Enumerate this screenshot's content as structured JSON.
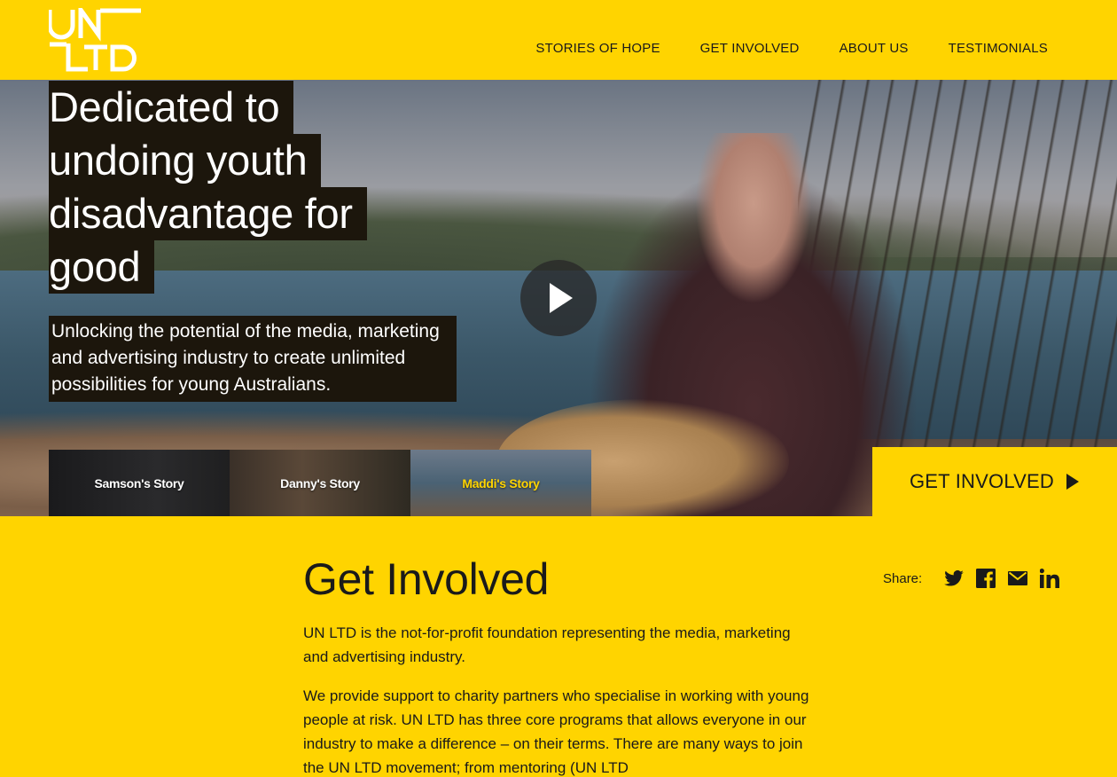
{
  "logo": {
    "line1": "UN",
    "line2": "LTD"
  },
  "nav": {
    "items": [
      "STORIES OF HOPE",
      "GET INVOLVED",
      "ABOUT US",
      "TESTIMONIALS"
    ]
  },
  "hero": {
    "headline": [
      "Dedicated to",
      "undoing youth",
      "disadvantage for",
      "good"
    ],
    "subline": "Unlocking the potential of the media, marketing and advertising industry to create unlimited possibilities for young Australians.",
    "play_icon": "play-icon",
    "stories": [
      {
        "label": "Samson's Story",
        "active": false
      },
      {
        "label": "Danny's Story",
        "active": false
      },
      {
        "label": "Maddi's Story",
        "active": true
      }
    ],
    "cta_label": "GET INVOLVED"
  },
  "main": {
    "title": "Get Involved",
    "paragraphs": [
      "UN LTD is the not-for-profit foundation representing the media, marketing and advertising industry.",
      "We provide support to charity partners who specialise in working with young people at risk. UN LTD has three core programs that allows everyone in our industry to make a difference – on their terms. There are many ways to join the UN LTD movement; from mentoring (UN LTD"
    ]
  },
  "share": {
    "label": "Share:",
    "icons": [
      "twitter-icon",
      "facebook-icon",
      "email-icon",
      "linkedin-icon"
    ]
  },
  "colors": {
    "brand_yellow": "#FFD400",
    "text_dark": "#1a1a1a",
    "overlay_dark": "#1c160c"
  }
}
